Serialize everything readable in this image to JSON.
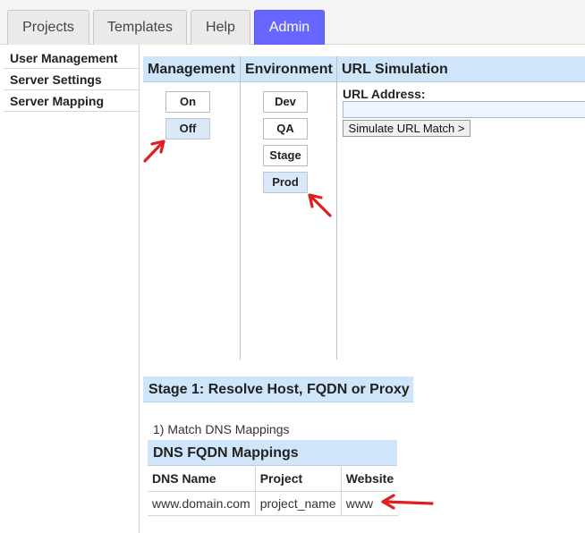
{
  "tabs": [
    {
      "label": "Projects",
      "active": false
    },
    {
      "label": "Templates",
      "active": false
    },
    {
      "label": "Help",
      "active": false
    },
    {
      "label": "Admin",
      "active": true
    }
  ],
  "sidebar": {
    "items": [
      {
        "label": "User Management"
      },
      {
        "label": "Server Settings"
      },
      {
        "label": "Server Mapping"
      }
    ]
  },
  "panels": {
    "management": {
      "title": "Management",
      "buttons": [
        {
          "label": "On",
          "selected": false
        },
        {
          "label": "Off",
          "selected": true
        }
      ]
    },
    "environment": {
      "title": "Environment",
      "buttons": [
        {
          "label": "Dev",
          "selected": false
        },
        {
          "label": "QA",
          "selected": false
        },
        {
          "label": "Stage",
          "selected": false
        },
        {
          "label": "Prod",
          "selected": true
        }
      ]
    },
    "url_simulation": {
      "title": "URL Simulation",
      "address_label": "URL Address:",
      "address_value": "",
      "simulate_button": "Simulate URL Match >"
    }
  },
  "stage1": {
    "title": "Stage 1: Resolve Host, FQDN or Proxy",
    "match_text": "1) Match DNS Mappings"
  },
  "dns_table": {
    "title": "DNS FQDN Mappings",
    "headers": [
      "DNS Name",
      "Project",
      "Website"
    ],
    "rows": [
      [
        "www.domain.com",
        "project_name",
        "www"
      ]
    ]
  },
  "colors": {
    "active_tab": "#6767ff",
    "panel_header": "#cfe5fa",
    "selected_button": "#dbe8f8",
    "annotation_arrow": "#e11d1d"
  },
  "icons": {
    "annotation": "arrow-icon"
  }
}
